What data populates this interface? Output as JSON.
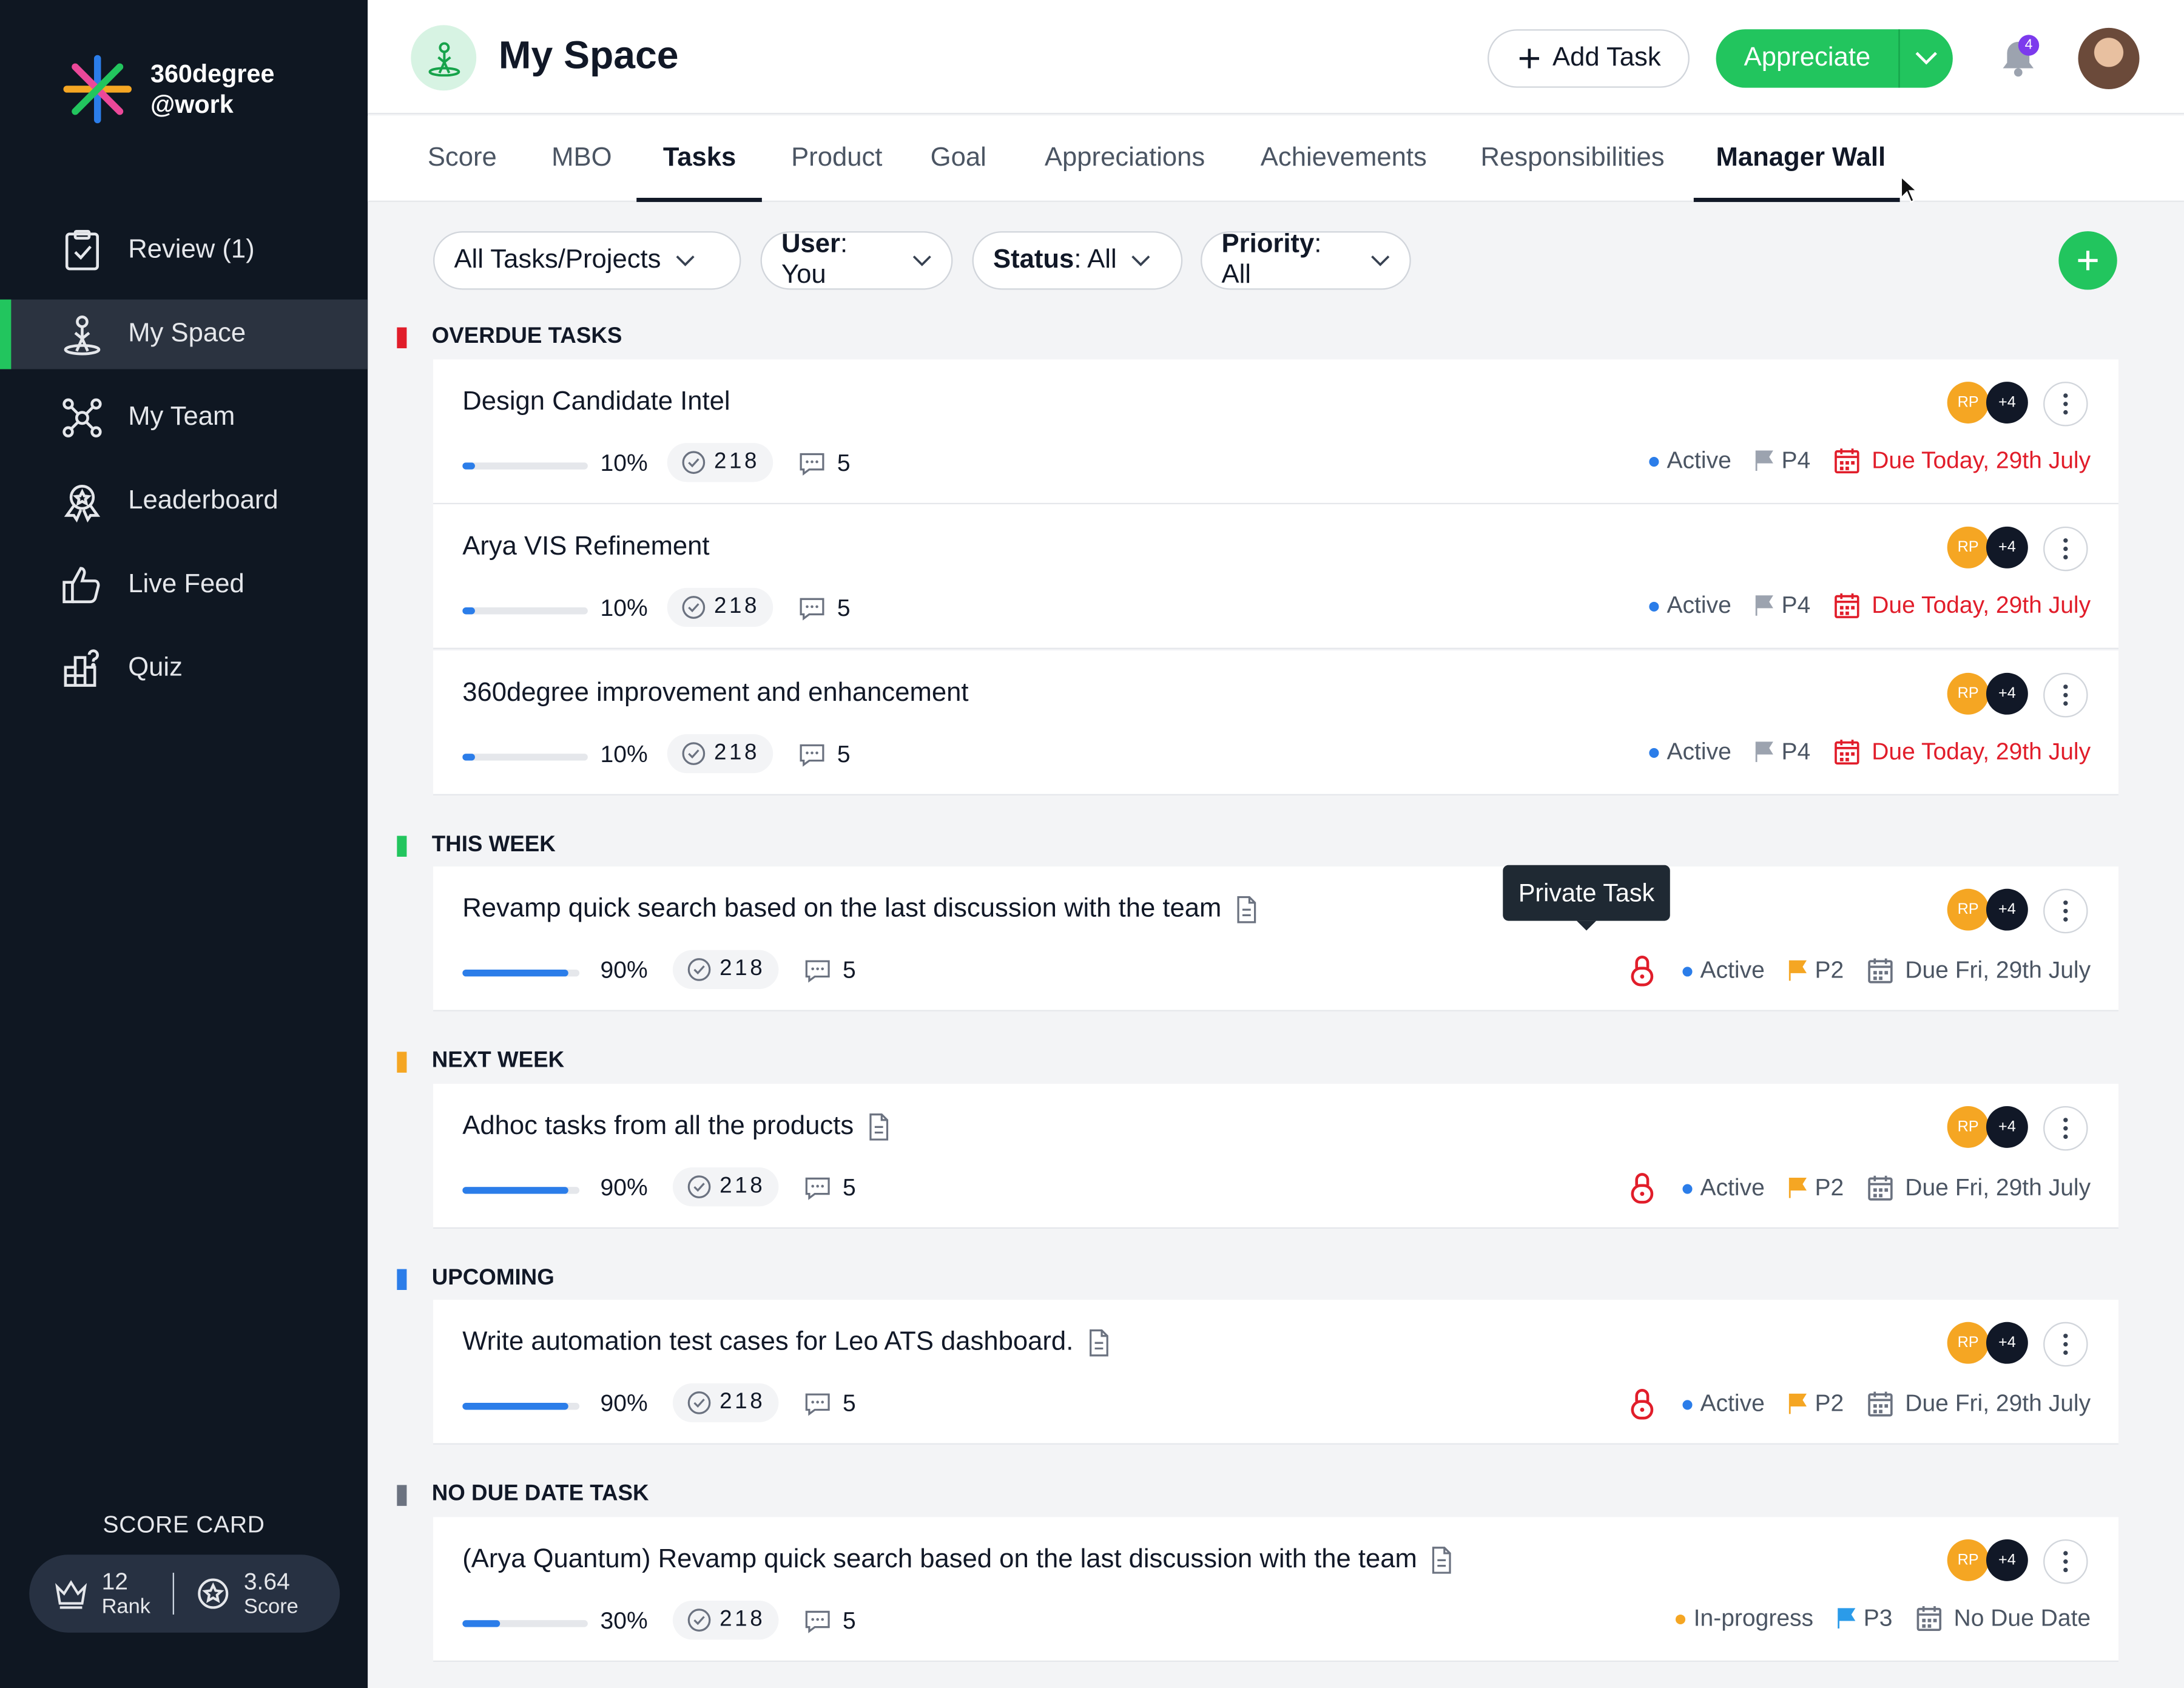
{
  "app": {
    "logo_line1": "360degree",
    "logo_line2": "@work"
  },
  "sidebar": {
    "items": [
      {
        "label": "Review (1)",
        "icon": "review-icon"
      },
      {
        "label": "My Space",
        "icon": "my-space-icon",
        "active": true
      },
      {
        "label": "My Team",
        "icon": "team-icon"
      },
      {
        "label": "Leaderboard",
        "icon": "leaderboard-icon"
      },
      {
        "label": "Live Feed",
        "icon": "thumbs-up-icon"
      },
      {
        "label": "Quiz",
        "icon": "quiz-icon"
      }
    ],
    "scorecard": {
      "title": "SCORE CARD",
      "rank_value": "12",
      "rank_label": "Rank",
      "score_value": "3.64",
      "score_label": "Score"
    }
  },
  "header": {
    "title": "My Space",
    "add_task_label": "Add Task",
    "appreciate_label": "Appreciate",
    "notification_count": "4"
  },
  "tabs": [
    "Score",
    "MBO",
    "Tasks",
    "Product",
    "Goal",
    "Appreciations",
    "Achievements",
    "Responsibilities",
    "Manager Wall"
  ],
  "active_tab": "Tasks",
  "filters": {
    "projects": "All Tasks/Projects",
    "user_key": "User",
    "user_val": ": You",
    "status_key": "Status",
    "status_val": ": All",
    "priority_key": "Priority",
    "priority_val": ": All"
  },
  "colors": {
    "accent": "#22c55e",
    "overdue": "#e11d2a",
    "this_week": "#22c55e",
    "next_week": "#f5a623",
    "upcoming": "#2b7de9",
    "no_due": "#6b7280"
  },
  "sections": [
    {
      "title": "OVERDUE TASKS",
      "tasks": [
        {
          "title": "Design Candidate Intel",
          "progress": 10,
          "progress_text": "10%",
          "subtasks": "218",
          "comments": "5",
          "status": "Active",
          "priority": "P4",
          "due": "Due Today, 29th July",
          "avatar": "RP",
          "more": "+4"
        },
        {
          "title": "Arya VIS Refinement",
          "progress": 10,
          "progress_text": "10%",
          "subtasks": "218",
          "comments": "5",
          "status": "Active",
          "priority": "P4",
          "due": "Due Today, 29th July",
          "avatar": "RP",
          "more": "+4"
        },
        {
          "title": "360degree improvement and enhancement",
          "progress": 10,
          "progress_text": "10%",
          "subtasks": "218",
          "comments": "5",
          "status": "Active",
          "priority": "P4",
          "due": "Due Today, 29th July",
          "avatar": "RP",
          "more": "+4"
        }
      ]
    },
    {
      "title": "THIS WEEK",
      "tasks": [
        {
          "title": "Revamp quick search based on the last discussion with the team",
          "progress": 90,
          "progress_text": "90%",
          "subtasks": "218",
          "comments": "5",
          "status": "Active",
          "priority": "P2",
          "due": "Due Fri, 29th July",
          "avatar": "RP",
          "more": "+4"
        }
      ]
    },
    {
      "title": "NEXT WEEK",
      "tasks": [
        {
          "title": "Adhoc tasks from all the products",
          "progress": 90,
          "progress_text": "90%",
          "subtasks": "218",
          "comments": "5",
          "status": "Active",
          "priority": "P2",
          "due": "Due Fri, 29th July",
          "avatar": "RP",
          "more": "+4"
        }
      ]
    },
    {
      "title": "UPCOMING",
      "tasks": [
        {
          "title": "Write automation test cases for Leo ATS dashboard.",
          "progress": 90,
          "progress_text": "90%",
          "subtasks": "218",
          "comments": "5",
          "status": "Active",
          "priority": "P2",
          "due": "Due Fri, 29th July",
          "avatar": "RP",
          "more": "+4"
        }
      ]
    },
    {
      "title": "NO DUE DATE TASK",
      "tasks": [
        {
          "title": "(Arya Quantum) Revamp quick search based on the last discussion with the team",
          "progress": 30,
          "progress_text": "30%",
          "subtasks": "218",
          "comments": "5",
          "status": "In-progress",
          "priority": "P3",
          "due": "No Due Date",
          "avatar": "RP",
          "more": "+4"
        }
      ]
    }
  ],
  "tooltip": "Private Task"
}
